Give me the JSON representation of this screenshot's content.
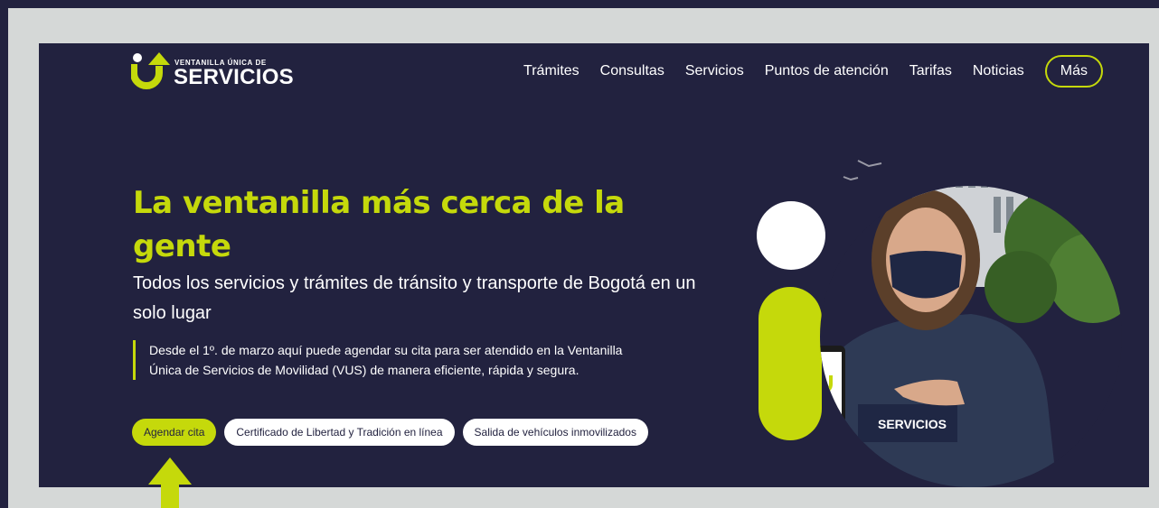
{
  "header": {
    "logo": {
      "small_text": "VENTANILLA ÚNICA DE",
      "big_text": "SERVICIOS"
    },
    "nav": [
      {
        "label": "Trámites"
      },
      {
        "label": "Consultas"
      },
      {
        "label": "Servicios"
      },
      {
        "label": "Puntos de atención"
      },
      {
        "label": "Tarifas"
      },
      {
        "label": "Noticias"
      }
    ],
    "more_button": "Más"
  },
  "hero": {
    "title": "La ventanilla más cerca de la gente",
    "subtitle": "Todos los servicios y trámites de tránsito y transporte de Bogotá en un solo lugar",
    "notice": "Desde el 1º. de marzo aquí puede agendar su cita para ser atendido en la Ventanilla Única de Servicios de Movilidad (VUS) de manera eficiente, rápida y segura.",
    "buttons": {
      "primary": "Agendar cita",
      "certificate": "Certificado de Libertad y Tradición en línea",
      "vehicles": "Salida de vehículos inmovilizados"
    },
    "jacket_logo_text": "SERVICIOS"
  },
  "colors": {
    "navy": "#22223f",
    "accent": "#c5d90b",
    "frame": "#d5d8d7",
    "white": "#ffffff"
  },
  "icons": [
    "logo-u-arrow-icon",
    "annotation-up-arrow-icon"
  ]
}
